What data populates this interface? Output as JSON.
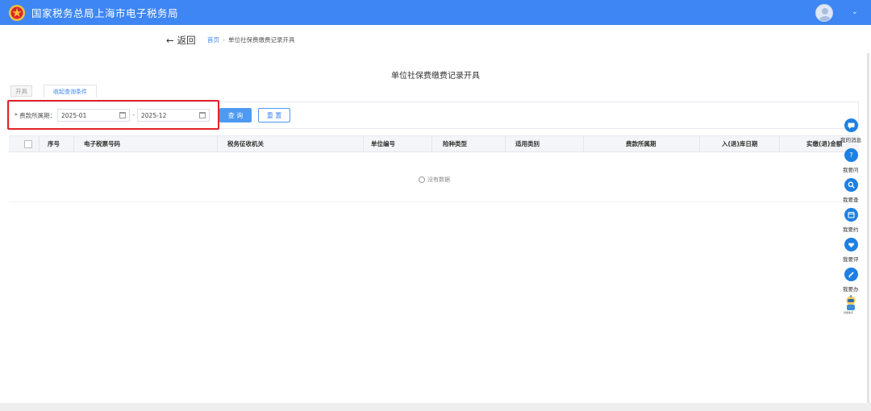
{
  "header": {
    "title": "国家税务总局上海市电子税务局",
    "brand_color": "#3d86f4"
  },
  "nav": {
    "back_label": "返回",
    "breadcrumb": [
      "首页",
      "单位社保费缴费记录开具"
    ]
  },
  "page": {
    "title": "单位社保费缴费记录开具"
  },
  "toolbar": {
    "open_label": "开具",
    "collapse_label": "收起查询条件"
  },
  "filter": {
    "period_label": "* 费款所属期：",
    "start_value": "2025-01",
    "end_value": "2025-12",
    "separator": "-",
    "query_label": "查 询",
    "reset_label": "重 置"
  },
  "table": {
    "columns": [
      "序号",
      "电子税票号码",
      "税务征收机关",
      "单位编号",
      "险种类型",
      "适用类别",
      "费款所属期",
      "入(退)库日期",
      "实缴(退)金额"
    ],
    "empty_text": "没有数据"
  },
  "sidebar": {
    "items": [
      {
        "label": "我的消息",
        "icon": "message-icon"
      },
      {
        "label": "我要问",
        "icon": "question-icon"
      },
      {
        "label": "我要查",
        "icon": "search-icon"
      },
      {
        "label": "我要约",
        "icon": "calendar-icon"
      },
      {
        "label": "我要评",
        "icon": "rate-icon"
      },
      {
        "label": "我要办",
        "icon": "edit-icon"
      }
    ],
    "assistant_label": "智能助手"
  },
  "colors": {
    "highlight": "#e3212b",
    "primary": "#4e9af2",
    "side_icon": "#1e80e2"
  }
}
